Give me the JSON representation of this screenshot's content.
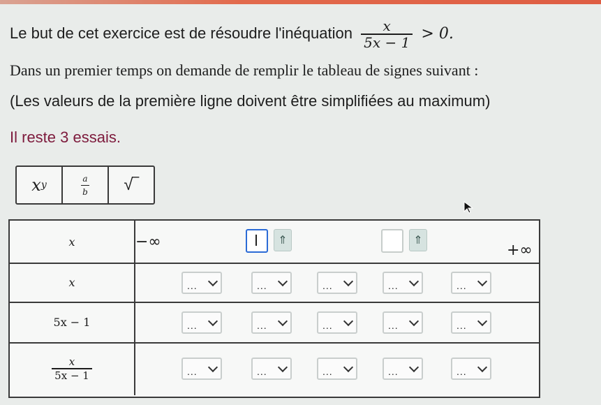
{
  "texts": {
    "intro_prefix": "Le but de cet exercice est de résoudre l'inéquation",
    "inequality_num": "x",
    "inequality_den": "5x − 1",
    "inequality_rhs": "> 0.",
    "line2": "Dans un premier temps on demande de remplir le tableau de signes suivant :",
    "line3": "(Les valeurs de la première ligne doivent être simplifiées au maximum)",
    "tries": "Il reste 3 essais."
  },
  "toolbar": {
    "power_label": "x",
    "power_sup": "y",
    "fraction_num": "a",
    "fraction_den": "b",
    "sqrt_label": "√‾"
  },
  "table": {
    "row_headers": [
      "x",
      "x",
      "5x − 1"
    ],
    "last_header_num": "x",
    "last_header_den": "5x − 1",
    "minus_inf": "−∞",
    "plus_inf": "+∞",
    "arrow_label": "⇑",
    "select_placeholder": "..."
  }
}
